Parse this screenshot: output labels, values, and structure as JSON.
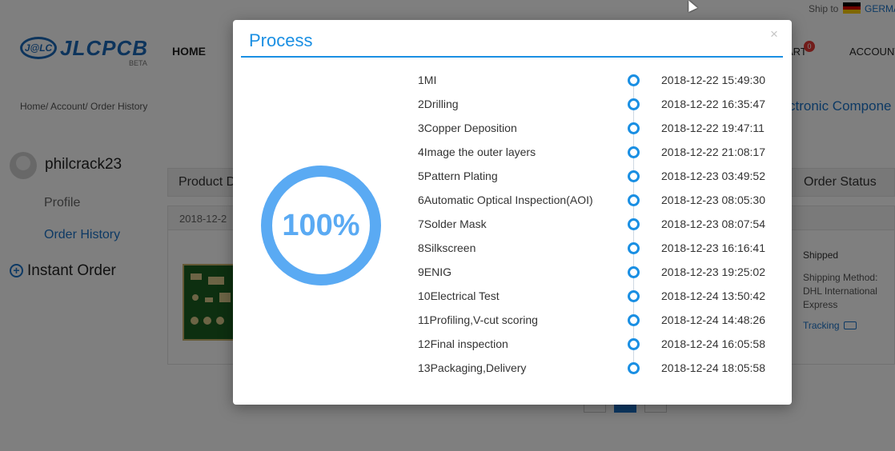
{
  "header": {
    "ship_to_label": "Ship to",
    "ship_to_country": "GERMA",
    "flag_colors": [
      "#000000",
      "#dd0000",
      "#ffce00"
    ],
    "logo_mark": "J@LC",
    "logo_text": "JLCPCB",
    "logo_badge": "BETA",
    "nav_home": "HOME",
    "nav_cart": "ART",
    "cart_count": "0",
    "nav_account": "ACCOUNT"
  },
  "breadcrumb": "Home/ Account/ Order History",
  "electronic_components": "ctronic Compone",
  "sidebar": {
    "username": "philcrack23",
    "profile": "Profile",
    "order_history": "Order History",
    "instant_order": "Instant Order"
  },
  "table": {
    "col_product": "Product D",
    "col_status": "Order Status",
    "order_date": "2018-12-2",
    "status": "Shipped",
    "shipping_method": "Shipping Method: DHL International Express",
    "tracking": "Tracking"
  },
  "modal": {
    "title": "Process",
    "close": "×",
    "progress_percent": 100,
    "progress_label": "100%",
    "accent_color": "#1a8fe3",
    "steps": [
      {
        "name": "1MI",
        "time": "2018-12-22 15:49:30"
      },
      {
        "name": "2Drilling",
        "time": "2018-12-22 16:35:47"
      },
      {
        "name": "3Copper Deposition",
        "time": "2018-12-22 19:47:11"
      },
      {
        "name": "4Image the outer layers",
        "time": "2018-12-22 21:08:17"
      },
      {
        "name": "5Pattern Plating",
        "time": "2018-12-23 03:49:52"
      },
      {
        "name": "6Automatic Optical Inspection(AOI)",
        "time": "2018-12-23 08:05:30"
      },
      {
        "name": "7Solder Mask",
        "time": "2018-12-23 08:07:54"
      },
      {
        "name": "8Silkscreen",
        "time": "2018-12-23 16:16:41"
      },
      {
        "name": "9ENIG",
        "time": "2018-12-23 19:25:02"
      },
      {
        "name": "10Electrical Test",
        "time": "2018-12-24 13:50:42"
      },
      {
        "name": "11Profiling,V-cut scoring",
        "time": "2018-12-24 14:48:26"
      },
      {
        "name": "12Final inspection",
        "time": "2018-12-24 16:05:58"
      },
      {
        "name": "13Packaging,Delivery",
        "time": "2018-12-24 18:05:58"
      }
    ]
  }
}
